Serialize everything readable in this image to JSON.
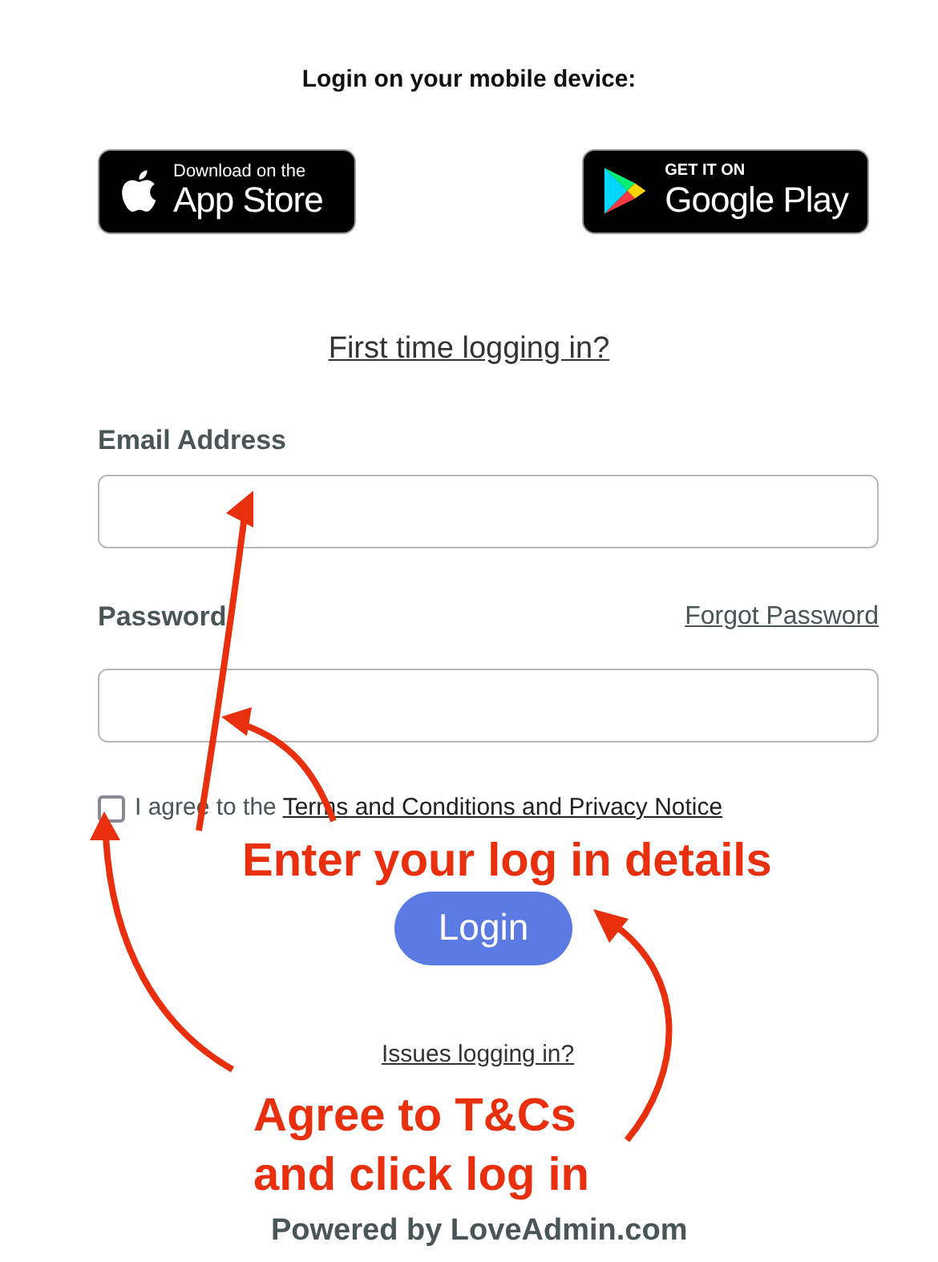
{
  "heading": "Login on your mobile device:",
  "store_badges": [
    {
      "kind": "apple",
      "small": "Download on the",
      "large": "App Store"
    },
    {
      "kind": "google",
      "small": "GET IT ON",
      "large": "Google Play"
    }
  ],
  "first_time_link": "First time logging in?",
  "fields": [
    {
      "label": "Email Address"
    },
    {
      "label": "Password",
      "link": "Forgot Password"
    }
  ],
  "agree": {
    "checked": false,
    "text": "I agree to the",
    "link": "Terms and Conditions and Privacy Notice"
  },
  "annotation_top": "Enter your log in details",
  "login_button": "Login",
  "issues_link": "Issues logging in?",
  "annotation_bottom": [
    "Agree to T&Cs",
    "and click log in"
  ],
  "powered_by": "Powered by LoveAdmin.com"
}
